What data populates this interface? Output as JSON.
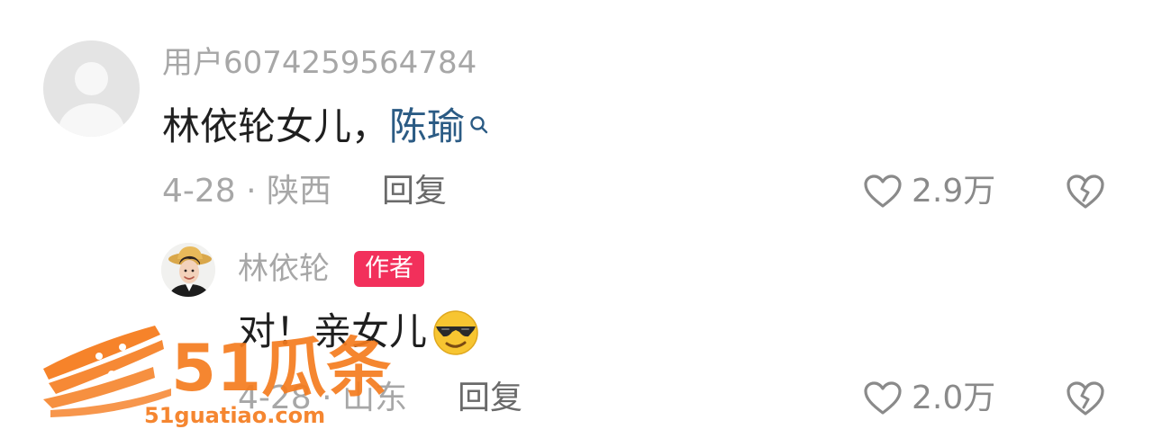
{
  "comment": {
    "username": "用户6074259564784",
    "text_main": "林依轮女儿，",
    "mention": "陈瑜",
    "date_location": "4-28 · 陕西",
    "reply_label": "回复",
    "like_count": "2.9万"
  },
  "reply": {
    "author_name": "林依轮",
    "author_badge": "作者",
    "text": "对！亲女儿",
    "emoji": "smiling-face-with-sunglasses",
    "date_location": "4-28 · 山东",
    "reply_label": "回复",
    "like_count": "2.0万"
  },
  "watermark": {
    "brand": "51瓜条",
    "url": "51guatiao.com"
  },
  "colors": {
    "mention": "#2b5b84",
    "badge": "#f2305b",
    "watermark": "#f57c1f",
    "secondary_text": "#a7a7a7"
  },
  "icons": {
    "like": "heart-outline-icon",
    "dislike": "broken-heart-icon",
    "search": "search-icon",
    "avatar_default": "default-avatar-icon"
  }
}
